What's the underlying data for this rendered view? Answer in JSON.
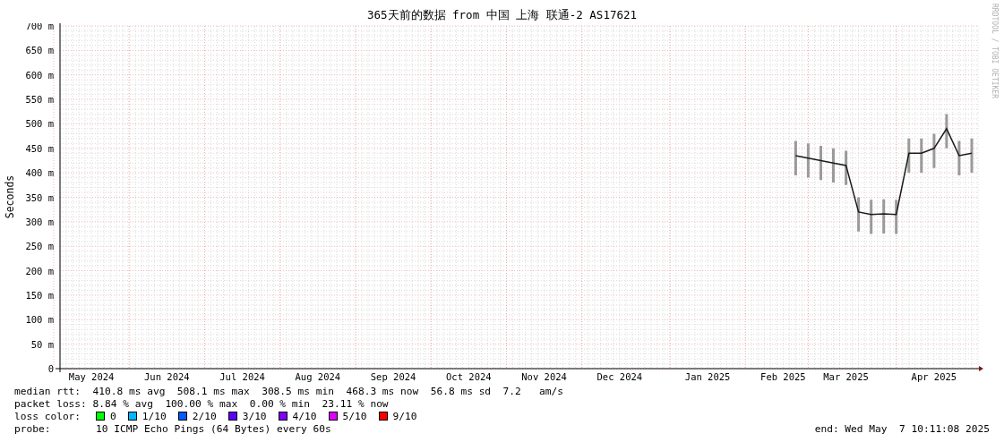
{
  "title": "365天前的数据 from 中国 上海 联通-2 AS17621",
  "credit": "RRDTOOL / TOBI OETIKER",
  "chart_data": {
    "type": "line",
    "ylabel": "Seconds",
    "grid": true,
    "ylim": [
      0,
      700
    ],
    "yticks": [
      {
        "value": 0,
        "label": "0"
      },
      {
        "value": 50,
        "label": "50 m"
      },
      {
        "value": 100,
        "label": "100 m"
      },
      {
        "value": 150,
        "label": "150 m"
      },
      {
        "value": 200,
        "label": "200 m"
      },
      {
        "value": 250,
        "label": "250 m"
      },
      {
        "value": 300,
        "label": "300 m"
      },
      {
        "value": 350,
        "label": "350 m"
      },
      {
        "value": 400,
        "label": "400 m"
      },
      {
        "value": 450,
        "label": "450 m"
      },
      {
        "value": 500,
        "label": "500 m"
      },
      {
        "value": 550,
        "label": "550 m"
      },
      {
        "value": 600,
        "label": "600 m"
      },
      {
        "value": 650,
        "label": "650 m"
      },
      {
        "value": 700,
        "label": "700 m"
      }
    ],
    "categories": [
      null,
      null,
      "May 2024",
      null,
      null,
      null,
      null,
      null,
      "Jun 2024",
      null,
      null,
      null,
      null,
      null,
      "Jul 2024",
      null,
      null,
      null,
      null,
      null,
      "Aug 2024",
      null,
      null,
      null,
      null,
      null,
      "Sep 2024",
      null,
      null,
      null,
      null,
      null,
      "Oct 2024",
      null,
      null,
      null,
      null,
      null,
      "Nov 2024",
      null,
      null,
      null,
      null,
      null,
      "Dec 2024",
      null,
      null,
      null,
      null,
      null,
      null,
      "Jan 2025",
      null,
      null,
      null,
      null,
      null,
      "Feb 2025",
      null,
      null,
      null,
      null,
      "Mar 2025",
      null,
      null,
      null,
      null,
      null,
      null,
      "Apr 2025",
      null,
      null,
      null
    ],
    "series": [
      {
        "color": "#1a1a1a",
        "values": [
          null,
          null,
          null,
          null,
          null,
          null,
          null,
          null,
          null,
          null,
          null,
          null,
          null,
          null,
          null,
          null,
          null,
          null,
          null,
          null,
          null,
          null,
          null,
          null,
          null,
          null,
          null,
          null,
          null,
          null,
          null,
          null,
          null,
          null,
          null,
          null,
          null,
          null,
          null,
          null,
          null,
          null,
          null,
          null,
          null,
          null,
          null,
          null,
          null,
          null,
          null,
          null,
          null,
          null,
          null,
          null,
          null,
          null,
          435,
          430,
          425,
          420,
          415,
          320,
          315,
          316,
          315,
          440,
          440,
          450,
          490,
          435,
          440
        ]
      }
    ]
  },
  "legend": {
    "median_rtt": "median rtt:  410.8 ms avg  508.1 ms max  308.5 ms min  468.3 ms now  56.8 ms sd  7.2   am/s",
    "packet_loss": "packet loss: 8.84 % avg  100.00 % max  0.00 % min  23.11 % now",
    "loss_color_label": "loss color:",
    "loss_colors": [
      {
        "label": "0",
        "color": "#00ff00"
      },
      {
        "label": "1/10",
        "color": "#00b8ff"
      },
      {
        "label": "2/10",
        "color": "#0059ff"
      },
      {
        "label": "3/10",
        "color": "#5e00ff"
      },
      {
        "label": "4/10",
        "color": "#7e00ff"
      },
      {
        "label": "5/10",
        "color": "#dd00ff"
      },
      {
        "label": "9/10",
        "color": "#ff0000"
      }
    ],
    "probe_label": "probe:",
    "probe": "10 ICMP Echo Pings (64 Bytes) every 60s",
    "end": "end: Wed May  7 10:11:08 2025"
  }
}
